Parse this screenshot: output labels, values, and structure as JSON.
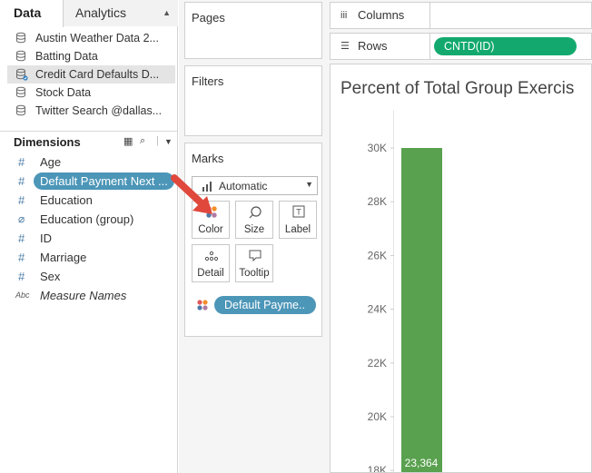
{
  "left": {
    "tabs": {
      "data": "Data",
      "analytics": "Analytics"
    },
    "datasources": [
      {
        "label": "Austin Weather Data 2...",
        "selected": false
      },
      {
        "label": "Batting Data",
        "selected": false
      },
      {
        "label": "Credit Card Defaults D...",
        "selected": true
      },
      {
        "label": "Stock Data",
        "selected": false
      },
      {
        "label": "Twitter Search @dallas...",
        "selected": false
      }
    ],
    "dimensions_title": "Dimensions",
    "fields": [
      {
        "icon": "#",
        "label": "Age"
      },
      {
        "icon": "#",
        "label": "Default Payment Next ..."
      },
      {
        "icon": "#",
        "label": "Education"
      },
      {
        "icon": "paperclip",
        "label": "Education (group)"
      },
      {
        "icon": "#",
        "label": "ID"
      },
      {
        "icon": "#",
        "label": "Marriage"
      },
      {
        "icon": "#",
        "label": "Sex"
      },
      {
        "icon": "Abc",
        "label": "Measure Names"
      }
    ]
  },
  "cards": {
    "pages": "Pages",
    "filters": "Filters",
    "marks": "Marks",
    "mark_type": "Automatic",
    "buttons": {
      "color": "Color",
      "size": "Size",
      "label": "Label",
      "detail": "Detail",
      "tooltip": "Tooltip"
    },
    "color_pill": "Default Payme.."
  },
  "shelves": {
    "columns": "Columns",
    "rows": "Rows",
    "rows_pill": "CNTD(ID)"
  },
  "view": {
    "title": "Percent of Total Group Exercis"
  },
  "colors": {
    "bar": "#59a14f",
    "pill_blue": "#4c96b8",
    "pill_green": "#13a96e",
    "arrow": "#e0483c"
  },
  "chart_data": {
    "type": "bar",
    "categories": [
      ""
    ],
    "values": [
      23364
    ],
    "data_labels": [
      "23,364"
    ],
    "y_ticks": [
      "30K",
      "28K",
      "26K",
      "24K",
      "22K",
      "20K",
      "18K"
    ],
    "y_tick_values": [
      30000,
      28000,
      26000,
      24000,
      22000,
      20000,
      18000
    ],
    "ylim": [
      18000,
      30000
    ],
    "bar_top_value": 30000
  }
}
